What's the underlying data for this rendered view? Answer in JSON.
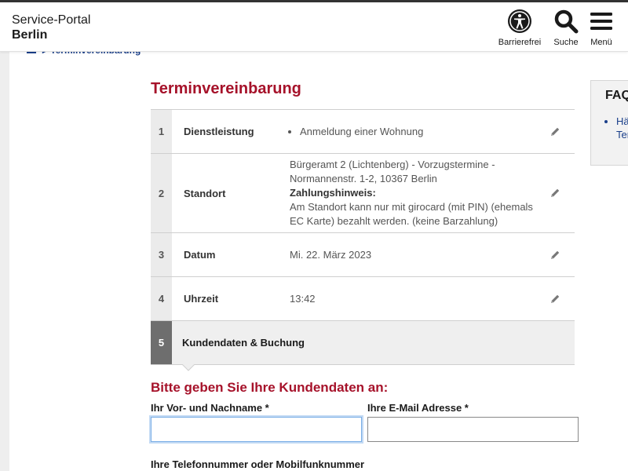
{
  "header": {
    "logo_line1": "Service-Portal",
    "logo_line2": "Berlin",
    "accessibility_label": "Barrierefrei",
    "search_label": "Suche",
    "menu_label": "Menü"
  },
  "breadcrumb": {
    "current": "Terminvereinbarung"
  },
  "page_title": "Terminvereinbarung",
  "steps": [
    {
      "num": "1",
      "label": "Dienstleistung",
      "value": "Anmeldung einer Wohnung"
    },
    {
      "num": "2",
      "label": "Standort",
      "value_line1": "Bürgeramt 2 (Lichtenberg) - Vorzugstermine -",
      "value_line2": "Normannenstr. 1-2, 10367 Berlin",
      "value_line3": "Zahlungshinweis:",
      "value_line4": "Am Standort kann nur mit girocard (mit PIN) (ehemals",
      "value_line5": "EC Karte) bezahlt werden. (keine Barzahlung)"
    },
    {
      "num": "3",
      "label": "Datum",
      "value": "Mi. 22. März 2023"
    },
    {
      "num": "4",
      "label": "Uhrzeit",
      "value": "13:42"
    },
    {
      "num": "5",
      "label": "Kundendaten & Buchung"
    }
  ],
  "form": {
    "heading": "Bitte geben Sie Ihre Kundendaten an:",
    "name_label": "Ihr Vor- und Nachname *",
    "name_value": "",
    "email_label": "Ihre E-Mail Adresse *",
    "email_value": "",
    "phone_label": "Ihre Telefonnummer oder Mobilfunknummer"
  },
  "faq": {
    "heading": "FAQ",
    "item1_line1": "Hä",
    "item1_line2": "Ter"
  },
  "colors": {
    "accent_red": "#a6122a",
    "link_blue": "#1a3f8a"
  }
}
